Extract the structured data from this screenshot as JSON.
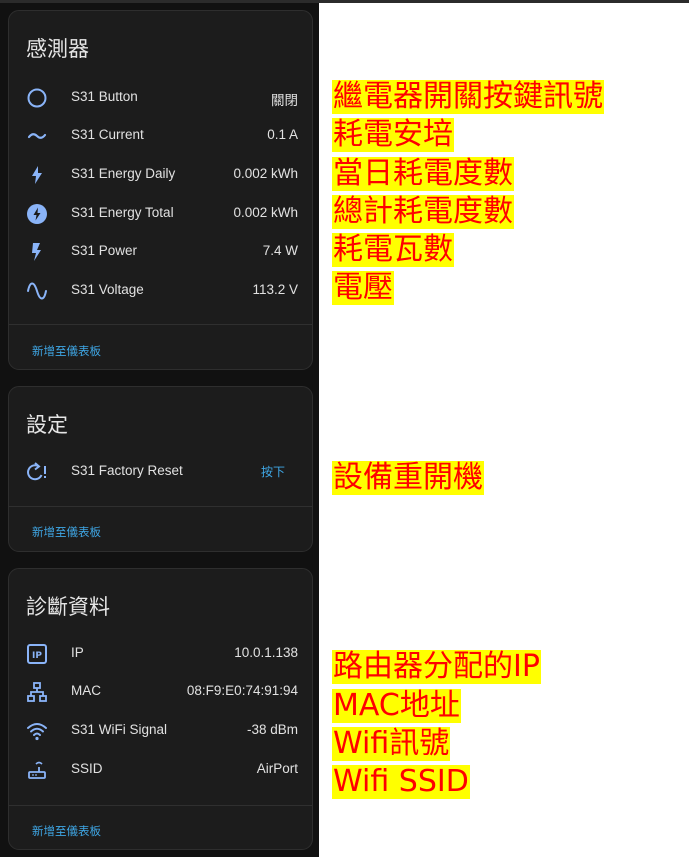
{
  "sensors": {
    "title": "感測器",
    "rows": [
      {
        "icon": "circle-outline-icon",
        "name": "S31 Button",
        "value": "關閉"
      },
      {
        "icon": "current-ac-icon",
        "name": "S31 Current",
        "value": "0.1 A"
      },
      {
        "icon": "lightning-bolt-icon",
        "name": "S31 Energy Daily",
        "value": "0.002 kWh"
      },
      {
        "icon": "lightning-circle-icon",
        "name": "S31 Energy Total",
        "value": "0.002 kWh"
      },
      {
        "icon": "flash-icon",
        "name": "S31 Power",
        "value": "7.4 W"
      },
      {
        "icon": "sine-wave-icon",
        "name": "S31 Voltage",
        "value": "113.2 V"
      }
    ],
    "add_label": "新增至儀表板"
  },
  "config": {
    "title": "設定",
    "rows": [
      {
        "icon": "restart-alert-icon",
        "name": "S31 Factory Reset",
        "button": "按下"
      }
    ],
    "add_label": "新增至儀表板"
  },
  "diagnostic": {
    "title": "診斷資料",
    "rows": [
      {
        "icon": "ip-icon",
        "name": "IP",
        "value": "10.0.1.138"
      },
      {
        "icon": "network-icon",
        "name": "MAC",
        "value": "08:F9:E0:74:91:94"
      },
      {
        "icon": "wifi-icon",
        "name": "S31 WiFi Signal",
        "value": "-38 dBm"
      },
      {
        "icon": "router-wireless-icon",
        "name": "SSID",
        "value": "AirPort"
      }
    ],
    "add_label": "新增至儀表板"
  },
  "annotations": {
    "sensors": [
      "繼電器開關按鍵訊號",
      "耗電安培",
      "當日耗電度數",
      "總計耗電度數",
      "耗電瓦數",
      "電壓"
    ],
    "config": [
      "設備重開機"
    ],
    "diagnostic": [
      "路由器分配的IP",
      "MAC地址",
      "Wifi訊號",
      "Wifi SSID"
    ]
  },
  "colors": {
    "card_bg": "#1c1c1c",
    "accent": "#3fa7e6",
    "icon": "#8ab4f8",
    "annotation_bg": "#ffff00",
    "annotation_text": "#ff0000"
  }
}
